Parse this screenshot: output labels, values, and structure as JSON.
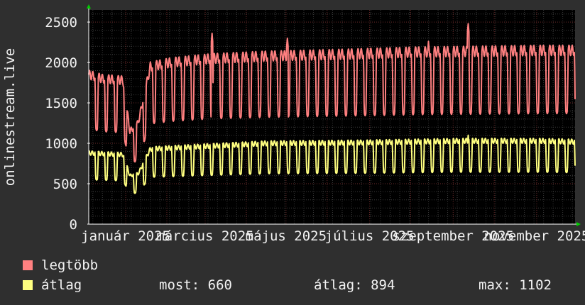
{
  "chart_data": {
    "type": "line",
    "ylabel": "onlinestream.live",
    "ylim": [
      0,
      2650
    ],
    "yticks": [
      0,
      500,
      1000,
      1500,
      2000,
      2500
    ],
    "xlabels": [
      "január 2025",
      "március 2025",
      "május 2025",
      "július 2025",
      "szeptember 2025",
      "november 2025"
    ],
    "xlabel_days": [
      27,
      85,
      144,
      205,
      266,
      327
    ],
    "xlim_days": [
      0,
      355
    ],
    "gap_days": [
      36,
      38
    ],
    "grid": true,
    "series": [
      {
        "name": "legtöbb",
        "color": "#ff8080",
        "weekday": 1850,
        "weekend": 1200,
        "profile": [
          [
            0,
            1850
          ],
          [
            10,
            1800
          ],
          [
            25,
            1780
          ],
          [
            30,
            1150
          ],
          [
            36,
            1250
          ],
          [
            45,
            1950
          ],
          [
            60,
            2000
          ],
          [
            90,
            2050
          ],
          [
            130,
            2080
          ],
          [
            180,
            2100
          ],
          [
            240,
            2130
          ],
          [
            330,
            2150
          ],
          [
            355,
            2150
          ]
        ],
        "peaks": [
          [
            90,
            2360
          ],
          [
            145,
            2300
          ],
          [
            277,
            2480
          ],
          [
            248,
            2260
          ]
        ]
      },
      {
        "name": "átlag",
        "color": "#ffff80",
        "weekday": 880,
        "weekend": 560,
        "profile": [
          [
            0,
            880
          ],
          [
            25,
            860
          ],
          [
            30,
            600
          ],
          [
            36,
            620
          ],
          [
            45,
            930
          ],
          [
            80,
            960
          ],
          [
            130,
            1000
          ],
          [
            200,
            1010
          ],
          [
            270,
            1030
          ],
          [
            330,
            1030
          ],
          [
            355,
            1020
          ]
        ],
        "peaks": [
          [
            277,
            1100
          ]
        ]
      }
    ]
  },
  "legend": {
    "max_label": "legtöbb",
    "avg_label": "átlag",
    "now_label": "most:",
    "now_value": "660",
    "avg_stat_label": "átlag:",
    "avg_stat_value": "894",
    "max_stat_label": "max:",
    "max_stat_value": "1102"
  }
}
